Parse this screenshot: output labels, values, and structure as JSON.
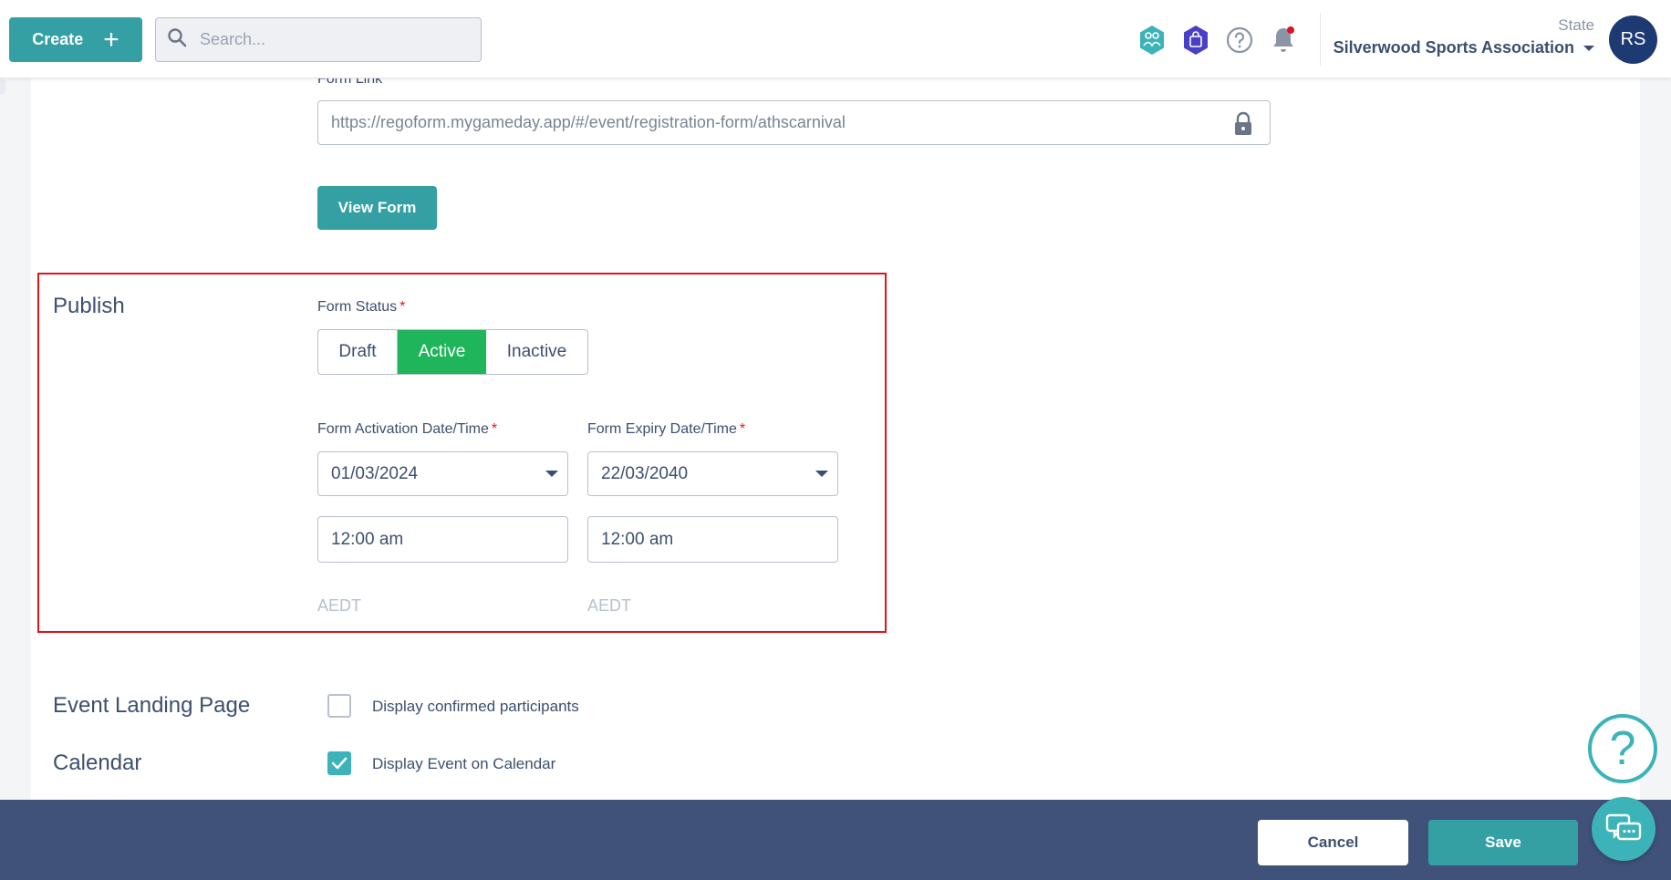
{
  "header": {
    "create_label": "Create",
    "search_placeholder": "Search...",
    "org_state": "State",
    "org_name": "Silverwood Sports Association",
    "avatar_initials": "RS"
  },
  "form_link": {
    "label": "Form Link",
    "value": "https://regoform.mygameday.app/#/event/registration-form/athscarnival",
    "view_button": "View Form"
  },
  "publish": {
    "title": "Publish",
    "status_label": "Form Status",
    "status_options": [
      "Draft",
      "Active",
      "Inactive"
    ],
    "status_selected": "Active",
    "activation_label": "Form Activation Date/Time",
    "activation_date": "01/03/2024",
    "activation_time": "12:00 am",
    "activation_tz": "AEDT",
    "expiry_label": "Form Expiry Date/Time",
    "expiry_date": "22/03/2040",
    "expiry_time": "12:00 am",
    "expiry_tz": "AEDT"
  },
  "landing_page": {
    "title": "Event Landing Page",
    "checkbox_label": "Display confirmed participants",
    "checked": false
  },
  "calendar": {
    "title": "Calendar",
    "checkbox_label": "Display Event on Calendar",
    "checked": true
  },
  "footer": {
    "cancel_label": "Cancel",
    "save_label": "Save"
  },
  "colors": {
    "accent": "#34a0a4",
    "active_green": "#1fb55a",
    "footer_bg": "#40527a",
    "highlight_red": "#e0121d"
  }
}
